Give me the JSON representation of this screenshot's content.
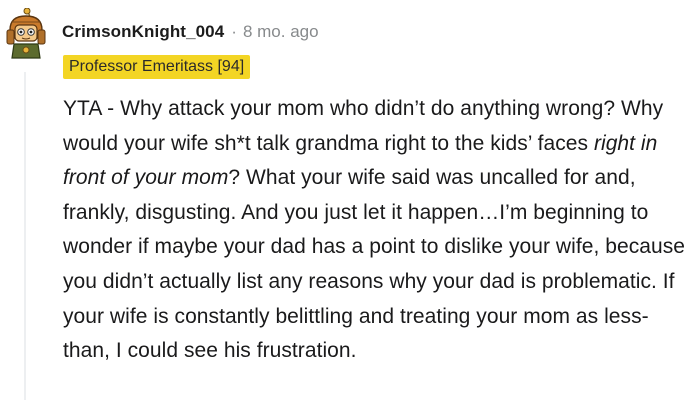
{
  "comment": {
    "username": "CrimsonKnight_004",
    "separator": "·",
    "age": "8 mo. ago",
    "flair": "Professor Emeritass [94]",
    "avatar_icon": "snoo-knight-avatar-icon",
    "flair_color": "#f3d524",
    "body": {
      "before_em": "YTA - Why attack your mom who didn’t do anything wrong? Why would your wife sh*t talk grandma right to the kids’ faces ",
      "em": "right in front of your mom",
      "after_em": "? What your wife said was uncalled for and, frankly, disgusting. And you just let it happen…I’m beginning to wonder if maybe your dad has a point to dislike your wife, because you didn’t actually list any reasons why your dad is problematic. If your wife is constantly belittling and treating your mom as less-than, I could see his frustration."
    }
  }
}
